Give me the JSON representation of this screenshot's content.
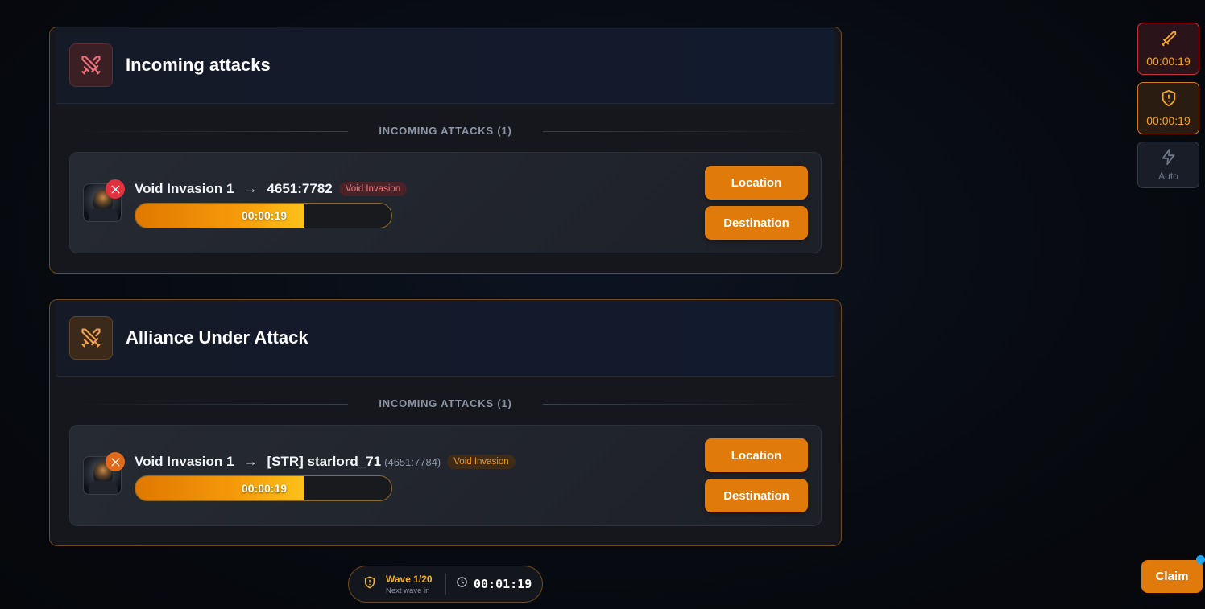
{
  "panels": [
    {
      "title": "Incoming attacks",
      "section_label": "INCOMING ATTACKS (1)",
      "attack": {
        "attacker": "Void Invasion 1",
        "arrow": "→",
        "target": "4651:7782",
        "target_coords": "",
        "tag": "Void Invasion",
        "timer": "00:00:19",
        "progress": 0.66,
        "location_label": "Location",
        "destination_label": "Destination"
      }
    },
    {
      "title": "Alliance Under Attack",
      "section_label": "INCOMING ATTACKS (1)",
      "attack": {
        "attacker": "Void Invasion 1",
        "arrow": "→",
        "target": "[STR] starlord_71",
        "target_coords": "(4651:7784)",
        "tag": "Void Invasion",
        "timer": "00:00:19",
        "progress": 0.66,
        "location_label": "Location",
        "destination_label": "Destination"
      }
    }
  ],
  "side_buttons": {
    "attack_timer": "00:00:19",
    "defense_timer": "00:00:19",
    "auto_label": "Auto"
  },
  "wave": {
    "title": "Wave 1/20",
    "subtitle": "Next wave in",
    "timer": "00:01:19"
  },
  "claim_label": "Claim",
  "colors": {
    "accent_orange": "#e07a0a",
    "danger_red": "#e0313f",
    "gold": "#f5a623"
  }
}
